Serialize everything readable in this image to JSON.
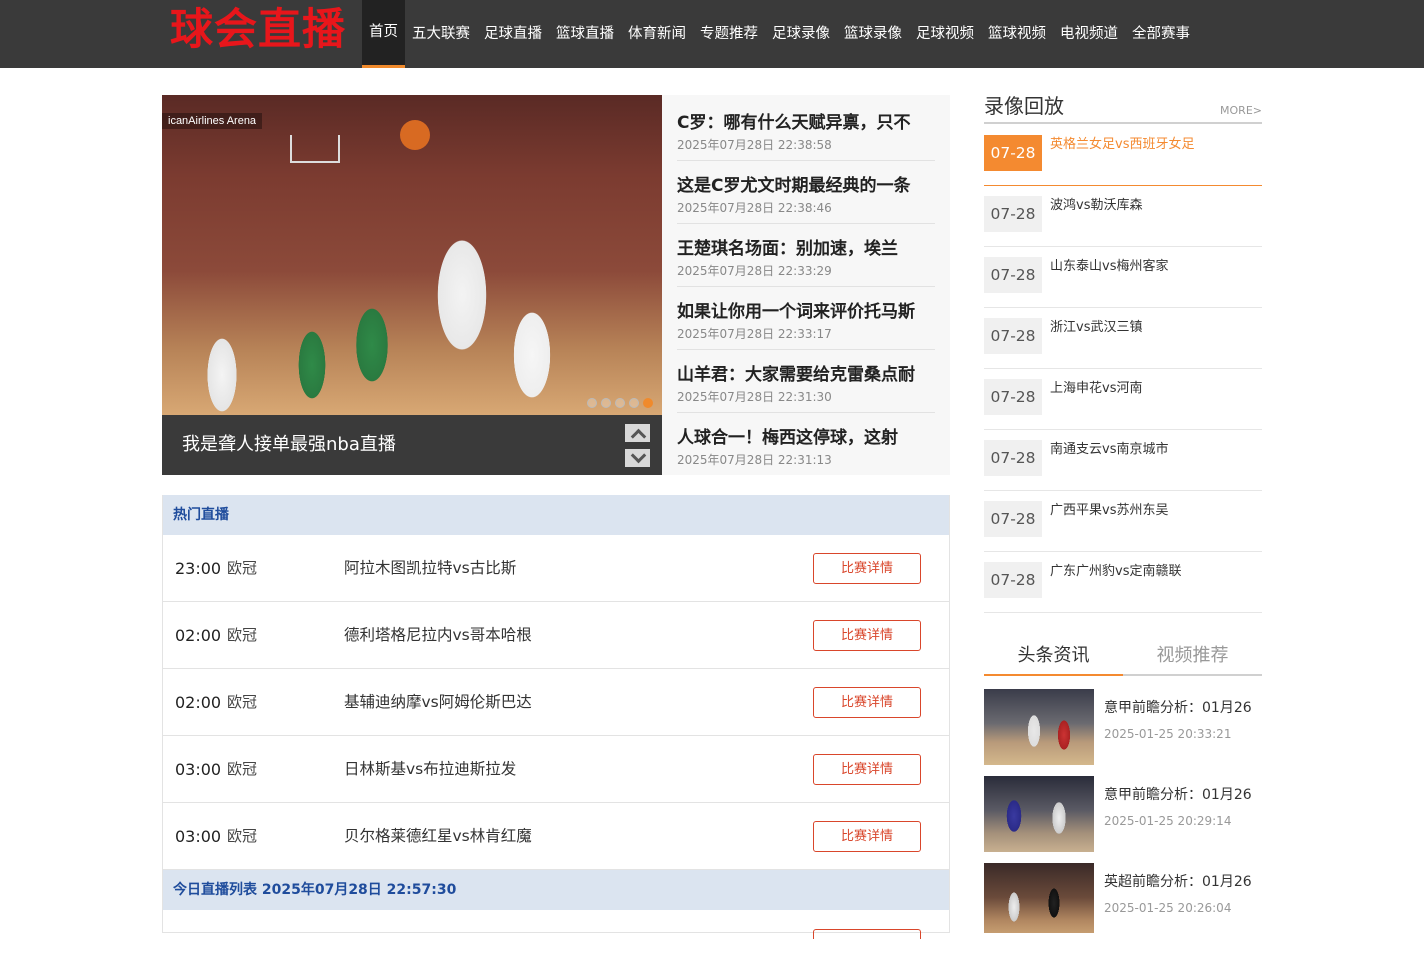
{
  "header": {
    "logo": "球会直播",
    "nav": [
      "首页",
      "五大联赛",
      "足球直播",
      "篮球直播",
      "体育新闻",
      "专题推荐",
      "足球录像",
      "篮球录像",
      "足球视频",
      "篮球视频",
      "电视频道",
      "全部赛事"
    ],
    "active_nav_index": 0
  },
  "slider": {
    "arena_text": "icanAirlines Arena",
    "caption": "我是聋人接单最强nba直播",
    "dot_count": 5,
    "active_dot_index": 4
  },
  "news": [
    {
      "title": "C罗：哪有什么天赋异禀，只不",
      "time": "2025年07月28日 22:38:58"
    },
    {
      "title": "这是C罗尤文时期最经典的一条",
      "time": "2025年07月28日 22:38:46"
    },
    {
      "title": "王楚琪名场面：别加速，埃兰",
      "time": "2025年07月28日 22:33:29"
    },
    {
      "title": "如果让你用一个词来评价托马斯",
      "time": "2025年07月28日 22:33:17"
    },
    {
      "title": "山羊君：大家需要给克雷桑点耐",
      "time": "2025年07月28日 22:31:30"
    },
    {
      "title": "人球合一！梅西这停球，这射",
      "time": "2025年07月28日 22:31:13"
    }
  ],
  "hot_live": {
    "heading": "热门直播",
    "button_label": "比赛详情",
    "rows": [
      {
        "time": "23:00",
        "league": "欧冠",
        "match": "阿拉木图凯拉特vs古比斯"
      },
      {
        "time": "02:00",
        "league": "欧冠",
        "match": "德利塔格尼拉内vs哥本哈根"
      },
      {
        "time": "02:00",
        "league": "欧冠",
        "match": "基辅迪纳摩vs阿姆伦斯巴达"
      },
      {
        "time": "03:00",
        "league": "欧冠",
        "match": "日林斯基vs布拉迪斯拉发"
      },
      {
        "time": "03:00",
        "league": "欧冠",
        "match": "贝尔格莱德红星vs林肯红魔"
      }
    ],
    "today_heading": "今日直播列表 2025年07月28日 22:57:30"
  },
  "replay": {
    "title": "录像回放",
    "more": "MORE>",
    "items": [
      {
        "date": "07-28",
        "name": "英格兰女足vs西班牙女足"
      },
      {
        "date": "07-28",
        "name": "波鸿vs勒沃库森"
      },
      {
        "date": "07-28",
        "name": "山东泰山vs梅州客家"
      },
      {
        "date": "07-28",
        "name": "浙江vs武汉三镇"
      },
      {
        "date": "07-28",
        "name": "上海申花vs河南"
      },
      {
        "date": "07-28",
        "name": "南通支云vs南京城市"
      },
      {
        "date": "07-28",
        "name": "广西平果vs苏州东吴"
      },
      {
        "date": "07-28",
        "name": "广东广州豹vs定南赣联"
      }
    ],
    "active_index": 0
  },
  "info_tabs": {
    "tabs": [
      "头条资讯",
      "视频推荐"
    ],
    "active_index": 0,
    "videos": [
      {
        "title": "意甲前瞻分析：01月26",
        "time": "2025-01-25 20:33:21"
      },
      {
        "title": "意甲前瞻分析：01月26",
        "time": "2025-01-25 20:29:14"
      },
      {
        "title": "英超前瞻分析：01月26",
        "time": "2025-01-25 20:26:04"
      }
    ]
  },
  "colors": {
    "header_bg": "#3a3a3a",
    "logo": "#e8161b",
    "accent": "#f48a30",
    "section_head_bg": "#dbe4f0",
    "section_head_text": "#1f4c9c",
    "button_border": "#d9462b"
  }
}
